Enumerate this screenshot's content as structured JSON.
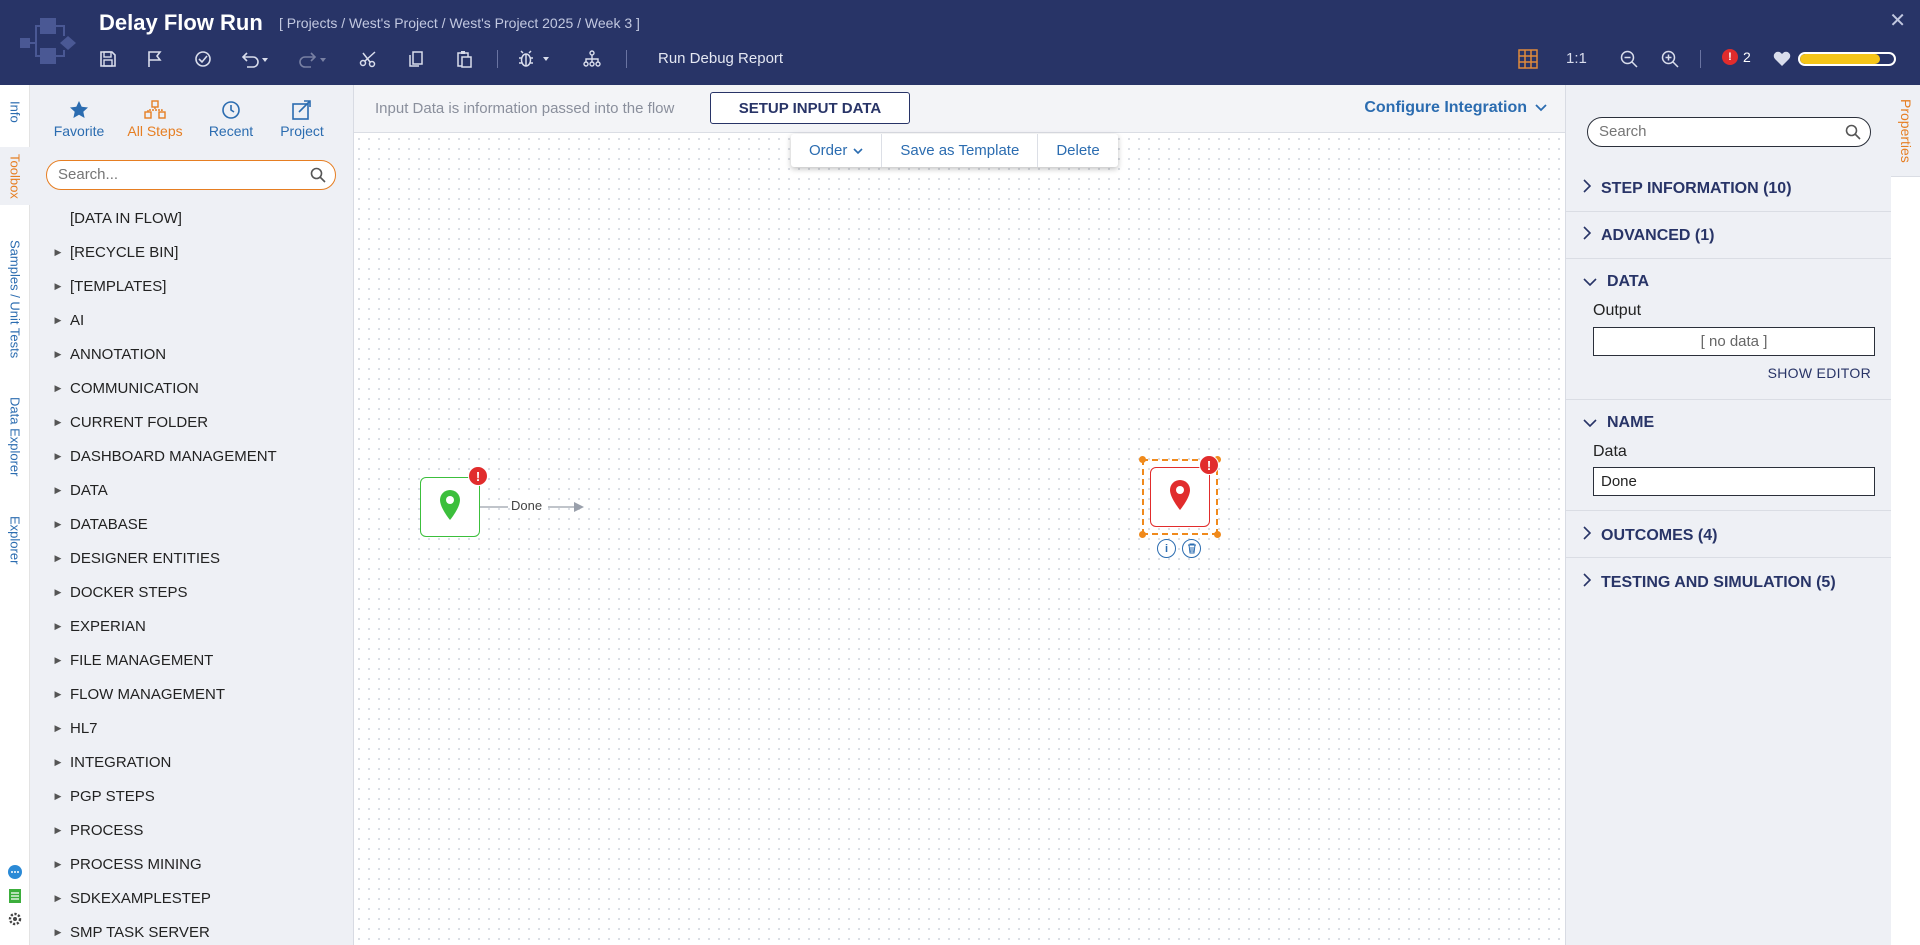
{
  "header": {
    "title": "Delay Flow Run",
    "breadcrumb": "[ Projects / West's Project / West's Project 2025 / Week 3 ]",
    "run_debug_label": "Run Debug Report",
    "zoom_ratio": "1:1",
    "error_count": "2",
    "health_level_percent": 85,
    "health_color": "#f5c518"
  },
  "left_tabs": [
    "Info",
    "Toolbox",
    "Samples / Unit Tests",
    "Data Explorer",
    "Explorer"
  ],
  "toolbox": {
    "tabs": [
      {
        "label": "Favorite",
        "icon": "star-icon"
      },
      {
        "label": "All Steps",
        "icon": "all-steps-icon"
      },
      {
        "label": "Recent",
        "icon": "clock-icon"
      },
      {
        "label": "Project",
        "icon": "project-icon"
      }
    ],
    "search_placeholder": "Search...",
    "items": [
      "[DATA IN FLOW]",
      "[RECYCLE BIN]",
      "[TEMPLATES]",
      "AI",
      "ANNOTATION",
      "COMMUNICATION",
      "CURRENT FOLDER",
      "DASHBOARD MANAGEMENT",
      "DATA",
      "DATABASE",
      "DESIGNER ENTITIES",
      "DOCKER STEPS",
      "EXPERIAN",
      "FILE MANAGEMENT",
      "FLOW MANAGEMENT",
      "HL7",
      "INTEGRATION",
      "PGP STEPS",
      "PROCESS",
      "PROCESS MINING",
      "SDKEXAMPLESTEP",
      "SMP TASK SERVER"
    ]
  },
  "canvas": {
    "input_text": "Input Data is information passed into the flow",
    "setup_button": "SETUP INPUT DATA",
    "configure_integration": "Configure Integration",
    "context_menu": {
      "order": "Order",
      "save_template": "Save as Template",
      "delete": "Delete"
    },
    "connector_label": "Done",
    "start_color": "#3cbf3c",
    "end_color": "#e12c2c",
    "selection_color": "#f08a1c"
  },
  "properties": {
    "tab_label": "Properties",
    "search_placeholder": "Search",
    "sections": {
      "step_information": "STEP INFORMATION (10)",
      "advanced": "ADVANCED (1)",
      "data": "DATA",
      "name": "NAME",
      "outcomes": "OUTCOMES (4)",
      "testing": "TESTING AND SIMULATION (5)"
    },
    "output_label": "Output",
    "output_value": "[ no data ]",
    "show_editor": "SHOW EDITOR",
    "data_label": "Data",
    "data_value": "Done"
  },
  "colors": {
    "header_bg": "#283467",
    "accent_orange": "#e67e22",
    "link_blue": "#2b6cb0",
    "error_red": "#e12c2c"
  }
}
